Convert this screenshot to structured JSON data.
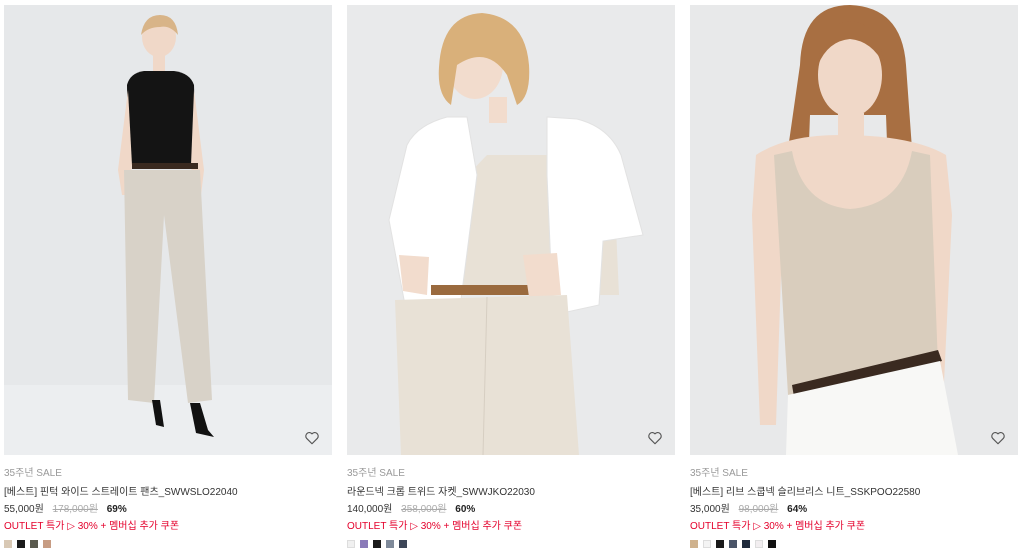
{
  "products": [
    {
      "event": "35주년 SALE",
      "name": "[베스트] 핀턱 와이드 스트레이트 팬츠_SWWSLO22040",
      "price": "55,000원",
      "original_price": "178,000원",
      "discount": "69%",
      "outlet": "OUTLET 특가 ▷ 30% + 멤버십 추가 쿠폰",
      "colors": [
        "#d8c8b4",
        "#1a1a1a",
        "#5a5a4e",
        "#c79c83"
      ],
      "photo": {
        "bg": "#e6e8ea",
        "top": "#141414",
        "bottom": "#d8d2c8",
        "skin": "#f0d8c8",
        "hair": "#d8b488"
      }
    },
    {
      "event": "35주년 SALE",
      "name": "라운드넥 크롭 트위드 자켓_SWWJKO22030",
      "price": "140,000원",
      "original_price": "358,000원",
      "discount": "60%",
      "outlet": "OUTLET 특가 ▷ 30% + 멤버십 추가 쿠폰",
      "colors": [
        "#f0f0f0",
        "#8a7ab8",
        "#1a1a1a",
        "#7f8a9a",
        "#3d4658"
      ],
      "photo": {
        "bg": "#e9eaeb",
        "top": "#ffffff",
        "bottom": "#e8e1d6",
        "skin": "#f2dccd",
        "hair": "#d9b07a"
      }
    },
    {
      "event": "35주년 SALE",
      "name": "[베스트] 리브 스쿱넥 슬리브리스 니트_SSKPOO22580",
      "price": "35,000원",
      "original_price": "98,000원",
      "discount": "64%",
      "outlet": "OUTLET 특가 ▷ 30% + 멤버십 추가 쿠폰",
      "colors": [
        "#cfb28e",
        "#f4f4f4",
        "#1a1a1a",
        "#4a5568",
        "#1f2a3c",
        "#f2eef0",
        "#111111"
      ],
      "photo": {
        "bg": "#e8e9ea",
        "top": "#d9cdbd",
        "bottom": "#f8f8f6",
        "skin": "#f0d8c8",
        "hair": "#a86f42"
      }
    }
  ]
}
